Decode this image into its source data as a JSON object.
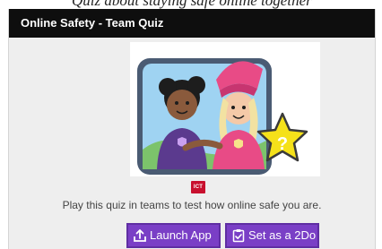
{
  "top_strip": {
    "text": "Quiz about staying safe online together"
  },
  "activity": {
    "title": "Online Safety - Team Quiz",
    "thumbnail_icon": "friends-with-star-illustration",
    "subject_badge": {
      "label": "ICT",
      "color": "#c8102e"
    },
    "description": "Play this quiz in teams to test how online safe you are."
  },
  "buttons": {
    "launch": {
      "label": "Launch App",
      "icon": "launch-icon"
    },
    "set_2do": {
      "label": "Set as a 2Do",
      "icon": "checklist-icon"
    }
  },
  "colors": {
    "header_bg": "#0e0e0e",
    "card_bg": "#eeeeee",
    "button_bg": "#7a3fc6"
  }
}
